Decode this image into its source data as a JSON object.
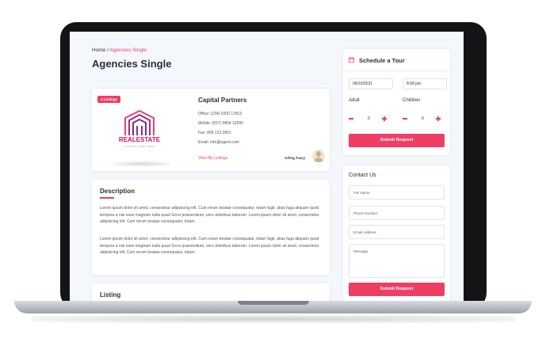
{
  "breadcrumb": {
    "home": "Home",
    "separator": " / ",
    "current": "Agencies Single"
  },
  "page_title": "Agencies Single",
  "agency": {
    "tag": "4 Listings",
    "logo_word": "REALESTATE",
    "logo_sub": "SLOGAN GOES HERE",
    "name": "Capital Partners",
    "office": "Office: (234) 0200 17813",
    "mobile": "Mobile: (657) 9854 12095",
    "fax": "Fax: 809 123 0951",
    "email": "Email: info@agent.com",
    "view_link": "View My Listings",
    "agent": "Arling Tracy"
  },
  "description": {
    "title": "Description",
    "para1": "Lorem ipsum dolor sit amet, consectetur adipisicing elit. Cum rerum beatae consequatur, totam fugit, alias fuga aliquam quod tempora a nisi esse magnam nulla quas! Error praesentium, vero doloribus laborum. Lorem ipsum dolor sit amet, consectetur adipisicing elit. Cum rerum beatae consequatur, totam.",
    "para2": "Lorem ipsum dolor sit amet, consectetur adipisicing elit. Cum rerum beatae consequatur, totam fugit, alias fuga aliquam quod tempora a nisi esse magnam nulla quas! Error praesentium, vero doloribus laborum. Lorem ipsum dolor sit amet, consectetur adipisicing elit. Cum rerum beatae consequatur, totam."
  },
  "listing": {
    "title": "Listing"
  },
  "schedule": {
    "title": "Schedule a Tour",
    "date": "09/10/2021",
    "time": "8:08 pm",
    "adult_label": "Adult",
    "children_label": "Children",
    "adult_count": "0",
    "children_count": "0",
    "submit": "Submit Request"
  },
  "contact": {
    "title": "Contact Us",
    "name_placeholder": "Full Name",
    "phone_placeholder": "Phone Number",
    "email_placeholder": "Email Address",
    "message_placeholder": "Message",
    "submit": "Submit Request"
  },
  "colors": {
    "accent": "#f03d63",
    "logo": "#c2185b",
    "background": "#f4f8fc"
  }
}
